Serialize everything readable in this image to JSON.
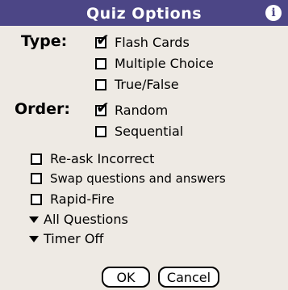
{
  "title": "Quiz Options",
  "info_glyph": "i",
  "type": {
    "label": "Type:",
    "options": [
      {
        "label": "Flash Cards",
        "checked": true
      },
      {
        "label": "Multiple Choice",
        "checked": false
      },
      {
        "label": "True/False",
        "checked": false
      }
    ]
  },
  "order": {
    "label": "Order:",
    "options": [
      {
        "label": "Random",
        "checked": true
      },
      {
        "label": "Sequential",
        "checked": false
      }
    ]
  },
  "settings": [
    {
      "label": "Re-ask Incorrect",
      "checked": false
    },
    {
      "label": "Swap questions and answers",
      "checked": false
    },
    {
      "label": "Rapid-Fire",
      "checked": false
    }
  ],
  "popups": {
    "questions": "All Questions",
    "timer": "Timer Off"
  },
  "buttons": {
    "ok": "OK",
    "cancel": "Cancel"
  },
  "check_mark": "✔"
}
